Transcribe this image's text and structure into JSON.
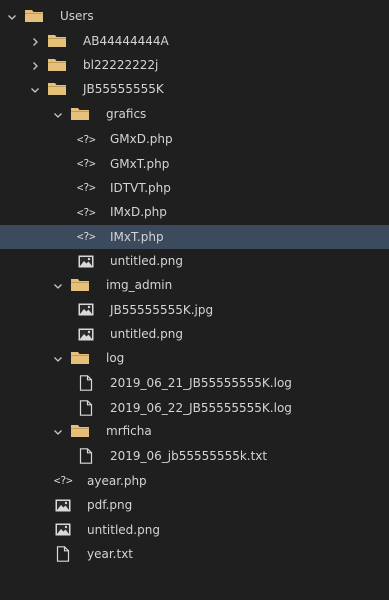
{
  "colors": {
    "background": "#1f1f1f",
    "selection": "#3b4a5c",
    "folder": "#e5c07b",
    "text": "#d4d4d4"
  },
  "tree": [
    {
      "name": "folder-users",
      "label": "Users",
      "type": "folder",
      "expanded": true,
      "depth": 0
    },
    {
      "name": "folder-ab44444444a",
      "label": "AB44444444A",
      "type": "folder",
      "expanded": false,
      "depth": 1
    },
    {
      "name": "folder-bl22222222j",
      "label": "bl22222222j",
      "type": "folder",
      "expanded": false,
      "depth": 1
    },
    {
      "name": "folder-jb55555555k",
      "label": "JB55555555K",
      "type": "folder",
      "expanded": true,
      "depth": 1
    },
    {
      "name": "folder-grafics",
      "label": "grafics",
      "type": "folder",
      "expanded": true,
      "depth": 2
    },
    {
      "name": "file-gmxd-php",
      "label": "GMxD.php",
      "type": "php",
      "depth": 3
    },
    {
      "name": "file-gmxt-php",
      "label": "GMxT.php",
      "type": "php",
      "depth": 3
    },
    {
      "name": "file-idtvt-php",
      "label": "IDTVT.php",
      "type": "php",
      "depth": 3
    },
    {
      "name": "file-imxd-php",
      "label": "IMxD.php",
      "type": "php",
      "depth": 3
    },
    {
      "name": "file-imxt-php",
      "label": "IMxT.php",
      "type": "php",
      "depth": 3,
      "selected": true
    },
    {
      "name": "file-untitled-png-grafics",
      "label": "untitled.png",
      "type": "image",
      "depth": 3
    },
    {
      "name": "folder-img-admin",
      "label": "img_admin",
      "type": "folder",
      "expanded": true,
      "depth": 2
    },
    {
      "name": "file-jb55555555k-jpg",
      "label": "JB55555555K.jpg",
      "type": "image",
      "depth": 3
    },
    {
      "name": "file-untitled-png-img-admin",
      "label": "untitled.png",
      "type": "image",
      "depth": 3
    },
    {
      "name": "folder-log",
      "label": "log",
      "type": "folder",
      "expanded": true,
      "depth": 2
    },
    {
      "name": "file-log-2019-06-21",
      "label": "2019_06_21_JB55555555K.log",
      "type": "file",
      "depth": 3
    },
    {
      "name": "file-log-2019-06-22",
      "label": "2019_06_22_JB55555555K.log",
      "type": "file",
      "depth": 3
    },
    {
      "name": "folder-mrficha",
      "label": "mrficha",
      "type": "folder",
      "expanded": true,
      "depth": 2
    },
    {
      "name": "file-mrficha-txt",
      "label": "2019_06_jb55555555k.txt",
      "type": "file",
      "depth": 3
    },
    {
      "name": "file-ayear-php",
      "label": "ayear.php",
      "type": "php",
      "depth": 2
    },
    {
      "name": "file-pdf-png",
      "label": "pdf.png",
      "type": "image",
      "depth": 2
    },
    {
      "name": "file-untitled-png-jb",
      "label": "untitled.png",
      "type": "image",
      "depth": 2
    },
    {
      "name": "file-year-txt",
      "label": "year.txt",
      "type": "file",
      "depth": 2
    }
  ]
}
